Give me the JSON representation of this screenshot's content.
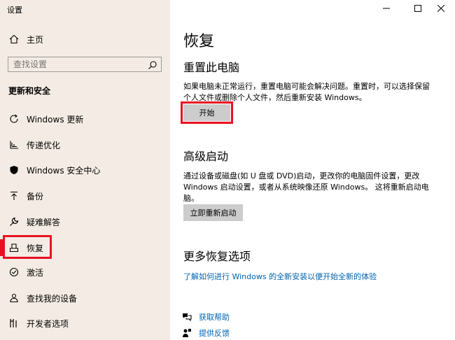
{
  "window": {
    "title": "设置"
  },
  "sidebar": {
    "home_label": "主页",
    "search_placeholder": "查找设置",
    "section_title": "更新和安全",
    "items": [
      {
        "label": "Windows 更新",
        "icon": "refresh-icon"
      },
      {
        "label": "传递优化",
        "icon": "delivery-icon"
      },
      {
        "label": "Windows 安全中心",
        "icon": "shield-icon"
      },
      {
        "label": "备份",
        "icon": "upload-icon"
      },
      {
        "label": "疑难解答",
        "icon": "wrench-icon"
      },
      {
        "label": "恢复",
        "icon": "recovery-icon"
      },
      {
        "label": "激活",
        "icon": "check-circle-icon"
      },
      {
        "label": "查找我的设备",
        "icon": "person-pin-icon"
      },
      {
        "label": "开发者选项",
        "icon": "developer-icon"
      }
    ]
  },
  "main": {
    "page_title": "恢复",
    "reset": {
      "heading": "重置此电脑",
      "desc": "如果电脑未正常运行，重置电脑可能会解决问题。重置时，可以选择保留个人文件或删除个人文件，然后重新安装 Windows。",
      "button": "开始"
    },
    "advanced": {
      "heading": "高级启动",
      "desc": "通过设备或磁盘(如 U 盘或 DVD)启动，更改你的电脑固件设置，更改 Windows 启动设置，或者从系统映像还原 Windows。 这将重新启动电脑。",
      "button": "立即重新启动"
    },
    "more": {
      "heading": "更多恢复选项",
      "link": "了解如何进行 Windows 的全新安装以便开始全新的体验"
    },
    "help": {
      "get_help": "获取帮助",
      "feedback": "提供反馈"
    }
  },
  "colors": {
    "accent": "#e81123",
    "link": "#0063b1",
    "sidebar_bg": "#f4ece4",
    "button_bg": "#cccccc"
  }
}
